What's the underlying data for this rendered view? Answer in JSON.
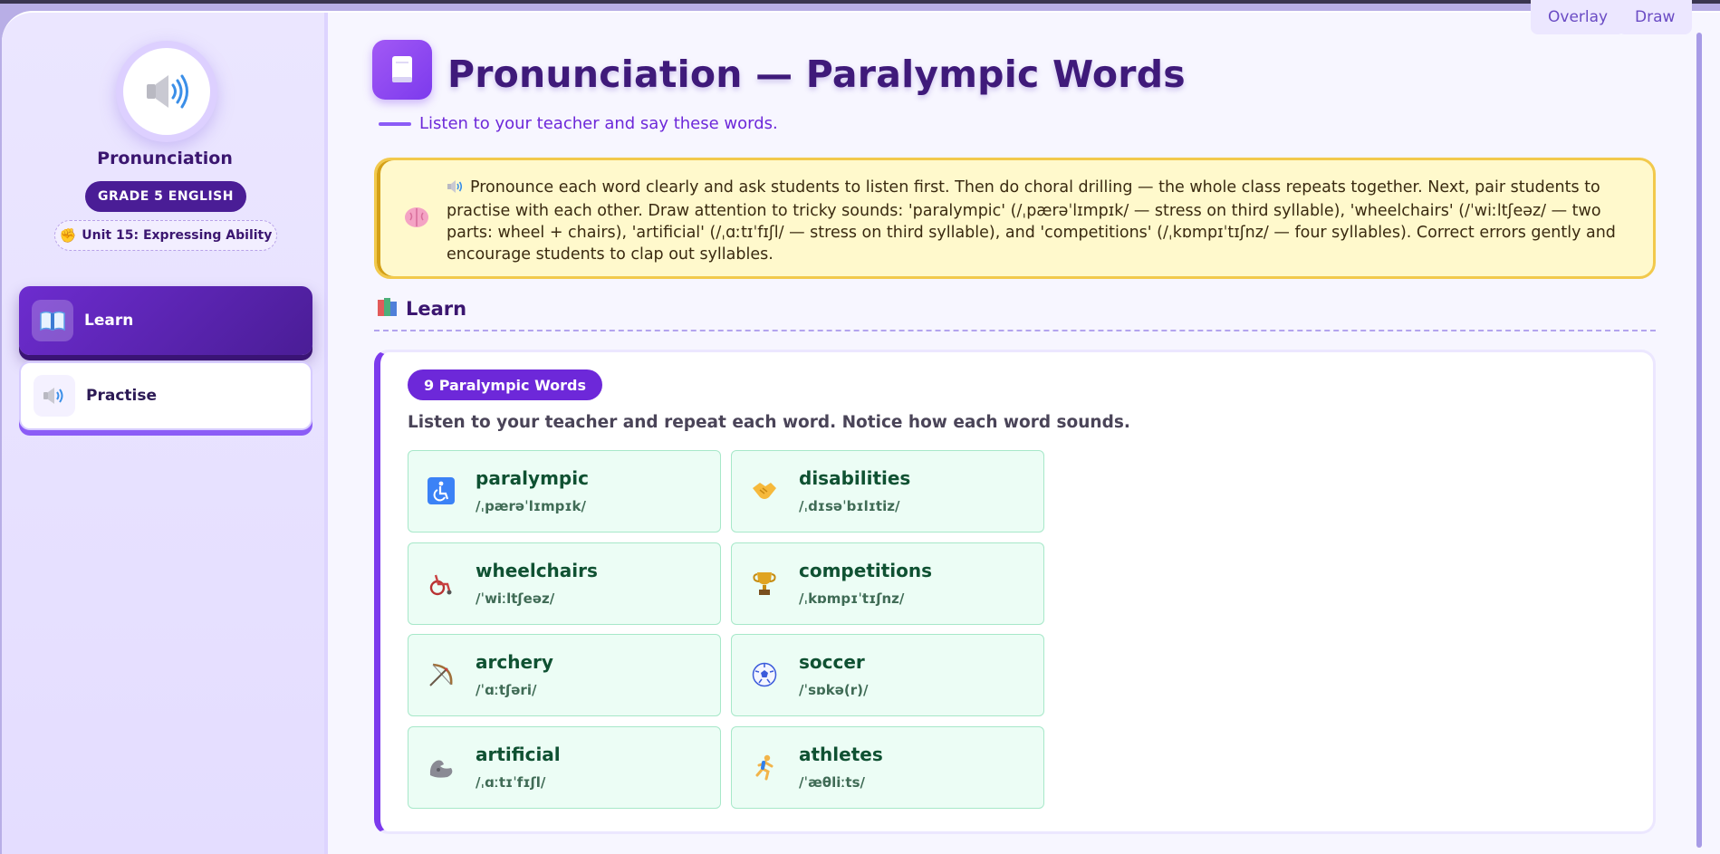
{
  "sidebar": {
    "brand_title": "Pronunciation",
    "grade_badge": "GRADE 5 ENGLISH",
    "unit_badge": "Unit 15: Expressing Ability",
    "unit_icon": "flexed-biceps-icon",
    "nav": [
      {
        "label": "Learn",
        "icon": "book-icon",
        "active": true
      },
      {
        "label": "Practise",
        "icon": "speaker-icon",
        "active": false
      }
    ]
  },
  "toolbar": {
    "overlay_label": "Overlay",
    "draw_label": "Draw"
  },
  "page": {
    "title": "Pronunciation — Paralympic Words",
    "subtitle": "Listen to your teacher and say these words."
  },
  "teacher_note": {
    "text": "Pronounce each word clearly and ask students to listen first. Then do choral drilling — the whole class repeats together. Next, pair students to practise with each other. Draw attention to tricky sounds: 'paralympic' (/ˌpærəˈlɪmpɪk/ — stress on third syllable), 'wheelchairs' (/ˈwiːltʃeəz/ — two parts: wheel + chairs), 'artificial' (/ˌɑːtɪˈfɪʃl/ — stress on third syllable), and 'competitions' (/ˌkɒmpɪˈtɪʃnz/ — four syllables). Correct errors gently and encourage students to clap out syllables."
  },
  "section": {
    "title": "Learn"
  },
  "card": {
    "count_label": "9 Paralympic Words",
    "instructions": "Listen to your teacher and repeat each word. Notice how each word sounds.",
    "words": [
      {
        "word": "paralympic",
        "ipa": "/ˌpærəˈlɪmpɪk/",
        "icon": "wheelchair-symbol-icon"
      },
      {
        "word": "disabilities",
        "ipa": "/ˌdɪsəˈbɪlɪtiz/",
        "icon": "handshake-icon"
      },
      {
        "word": "wheelchairs",
        "ipa": "/ˈwiːltʃeəz/",
        "icon": "wheelchair-icon"
      },
      {
        "word": "competitions",
        "ipa": "/ˌkɒmpɪˈtɪʃnz/",
        "icon": "trophy-icon"
      },
      {
        "word": "archery",
        "ipa": "/ˈɑːtʃəri/",
        "icon": "bow-and-arrow-icon"
      },
      {
        "word": "soccer",
        "ipa": "/ˈsɒkə(r)/",
        "icon": "soccer-ball-icon"
      },
      {
        "word": "artificial",
        "ipa": "/ˌɑːtɪˈfɪʃl/",
        "icon": "mechanical-arm-icon"
      },
      {
        "word": "athletes",
        "ipa": "/ˈæθliːts/",
        "icon": "runner-icon"
      }
    ]
  }
}
